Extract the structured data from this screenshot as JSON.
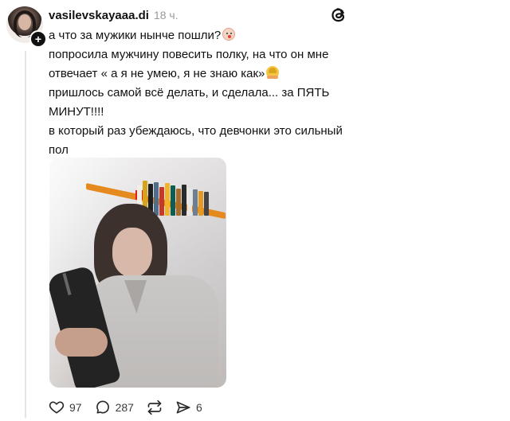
{
  "post": {
    "username": "vasilevskayaaa.di",
    "time": "18 ч.",
    "lines": [
      "а что за мужики нынче пошли?",
      "попросила мужчину повесить полку, на что он мне отвечает « а я не умею, я не знаю как»",
      "пришлось самой всё делать, и сделала... за ПЯТЬ МИНУТ!!!!",
      "в который раз убеждаюсь, что девчонки это сильный пол"
    ]
  },
  "actions": {
    "likes": "97",
    "comments": "287",
    "shares": "6"
  },
  "icons": {
    "threads": "threads-logo-icon",
    "like": "heart-icon",
    "comment": "comment-icon",
    "repost": "repost-icon",
    "share": "share-icon"
  }
}
